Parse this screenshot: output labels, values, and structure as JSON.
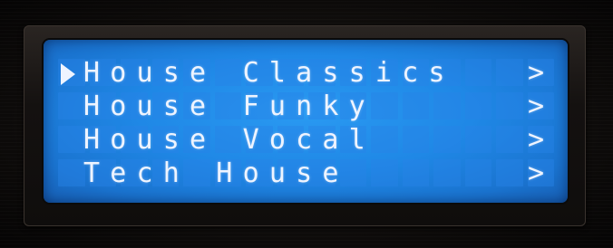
{
  "display": {
    "cursor_icon": "right-triangle-selector-icon",
    "items": [
      {
        "label": "House Classics",
        "arrow": ">",
        "selected": true
      },
      {
        "label": "House Funky",
        "arrow": ">",
        "selected": false
      },
      {
        "label": "House Vocal",
        "arrow": ">",
        "selected": false
      },
      {
        "label": "Tech House",
        "arrow": ">",
        "selected": false
      }
    ],
    "colors": {
      "backlight": "#1f88e6",
      "text": "#eef4ff",
      "bezel": "#141110"
    }
  }
}
